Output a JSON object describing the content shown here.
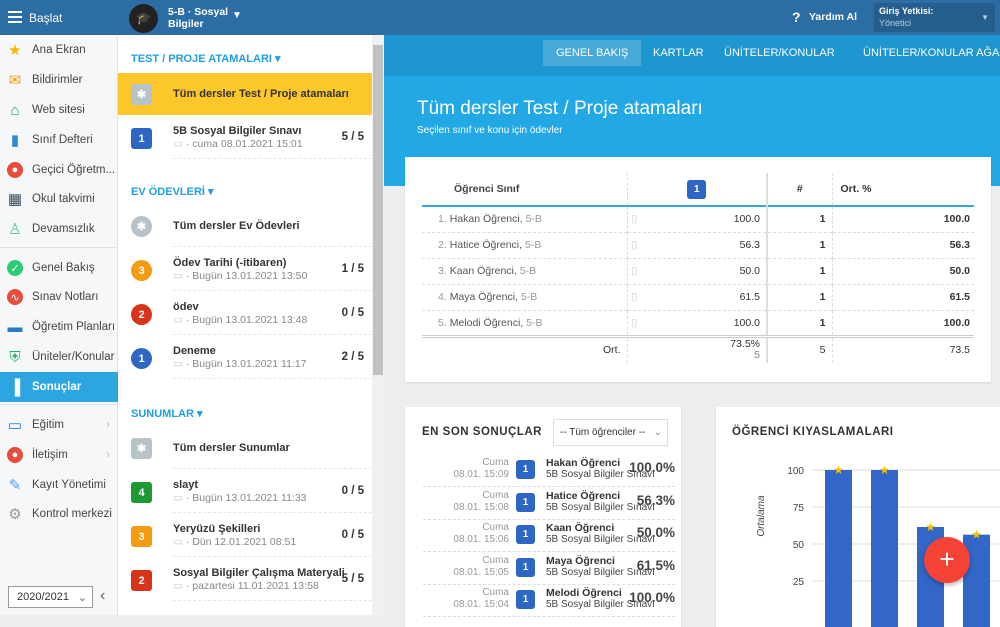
{
  "topbar": {
    "start": "Başlat",
    "course_line1": "5-B · Sosyal",
    "course_line2": "Bilgiler",
    "help": "Yardım Al",
    "auth_label": "Giriş Yetkisi:",
    "auth_value": "Yönetici"
  },
  "sidebar": {
    "items": [
      {
        "label": "Ana Ekran",
        "icon": "star-icon",
        "color": "#f5b800"
      },
      {
        "label": "Bildirimler",
        "icon": "mail-icon",
        "color": "#f39c12"
      },
      {
        "label": "Web sitesi",
        "icon": "home-icon",
        "color": "#17a57a"
      },
      {
        "label": "Sınıf Defteri",
        "icon": "book-icon",
        "color": "#2a8ad8"
      },
      {
        "label": "Geçici Öğretm...",
        "icon": "user-icon",
        "color": "#e74c3c"
      },
      {
        "label": "Okul takvimi",
        "icon": "calendar-icon",
        "color": "#34495e"
      },
      {
        "label": "Devamsızlık",
        "icon": "person-icon",
        "color": "#5cc0a0"
      },
      {
        "label": "Genel Bakış",
        "icon": "check-icon",
        "color": "#2ecc71"
      },
      {
        "label": "Sınav Notları",
        "icon": "chart-icon",
        "color": "#e74c3c"
      },
      {
        "label": "Öğretim Planları",
        "icon": "briefcase-icon",
        "color": "#2a7bc4"
      },
      {
        "label": "Üniteler/Konular",
        "icon": "shield-icon",
        "color": "#27ae60"
      },
      {
        "label": "Sonuçlar",
        "icon": "bar-chart-icon",
        "color": "#ffffff"
      },
      {
        "label": "Eğitim",
        "icon": "open-book-icon",
        "color": "#2a7bc4"
      },
      {
        "label": "İletişim",
        "icon": "chat-icon",
        "color": "#e74c3c"
      },
      {
        "label": "Kayıt Yönetimi",
        "icon": "pen-icon",
        "color": "#5aa0e0"
      },
      {
        "label": "Kontrol merkezi",
        "icon": "gear-icon",
        "color": "#999999"
      }
    ],
    "year": "2020/2021"
  },
  "middle": {
    "tests_title": "TEST / PROJE ATAMALARI",
    "tests": [
      {
        "title": "Tüm dersler Test / Proje atamaları"
      },
      {
        "badge": "1",
        "title": "5B Sosyal Bilgiler Sınavı",
        "sub": "· cuma 08.01.2021 15:01",
        "count": "5 / 5"
      }
    ],
    "homework_title": "EV ÖDEVLERİ",
    "homework": [
      {
        "title": "Tüm dersler Ev Ödevleri"
      },
      {
        "badge": "3",
        "color": "#f39c12",
        "title": "Ödev Tarihi (-itibaren)",
        "sub": "· Bugün 13.01.2021 13:50",
        "count": "1 / 5"
      },
      {
        "badge": "2",
        "color": "#d9331a",
        "title": "ödev",
        "sub": "· Bugün 13.01.2021 13:48",
        "count": "0 / 5"
      },
      {
        "badge": "1",
        "color": "#2e66c4",
        "title": "Deneme",
        "sub": "· Bugün 13.01.2021 11:17",
        "count": "2 / 5"
      }
    ],
    "presentations_title": "SUNUMLAR",
    "presentations": [
      {
        "title": "Tüm dersler Sunumlar"
      },
      {
        "badge": "4",
        "color": "#1e9a34",
        "title": "slayt",
        "sub": "· Bugün 13.01.2021 11:33",
        "count": "0 / 5"
      },
      {
        "badge": "3",
        "color": "#f39c12",
        "title": "Yeryüzü Şekilleri",
        "sub": "· Dün 12.01.2021 08:51",
        "count": "0 / 5"
      },
      {
        "badge": "2",
        "color": "#d9331a",
        "title": "Sosyal Bilgiler Çalışma Materyali",
        "sub": "· pazartesi 11.01.2021 13:58",
        "count": "5 / 5"
      }
    ]
  },
  "tabs": [
    "GENEL BAKIŞ",
    "KARTLAR",
    "ÜNİTELER/KONULAR",
    "ÜNİTELER/KONULAR AĞACI"
  ],
  "hero": {
    "title": "Tüm dersler Test / Proje atamaları",
    "subtitle": "Seçilen sınıf ve konu için ödevler"
  },
  "table": {
    "headers": {
      "student": "Öğrenci Sınıf",
      "test": "1",
      "count": "#",
      "avg": "Ort. %"
    },
    "rows": [
      {
        "num": "1.",
        "name": "Hakan Öğrenci,",
        "cls": "5-B",
        "score": "100.0",
        "count": "1",
        "avg": "100.0"
      },
      {
        "num": "2.",
        "name": "Hatice Öğrenci,",
        "cls": "5-B",
        "score": "56.3",
        "count": "1",
        "avg": "56.3"
      },
      {
        "num": "3.",
        "name": "Kaan Öğrenci,",
        "cls": "5-B",
        "score": "50.0",
        "count": "1",
        "avg": "50.0"
      },
      {
        "num": "4.",
        "name": "Maya Öğrenci,",
        "cls": "5-B",
        "score": "61.5",
        "count": "1",
        "avg": "61.5"
      },
      {
        "num": "5.",
        "name": "Melodi Öğrenci,",
        "cls": "5-B",
        "score": "100.0",
        "count": "1",
        "avg": "100.0"
      }
    ],
    "footer": {
      "label": "Ort.",
      "score": "73.5%",
      "score_n": "5",
      "count": "5",
      "avg": "73.5"
    }
  },
  "recent": {
    "title": "EN SON SONUÇLAR",
    "filter": "-- Tüm öğrenciler --",
    "items": [
      {
        "day": "Cuma",
        "time": "08.01. 15:09",
        "badge": "1",
        "name": "Hakan Öğrenci",
        "test": "5B Sosyal Bilgiler Sınavı",
        "pct": "100.0%"
      },
      {
        "day": "Cuma",
        "time": "08.01. 15:08",
        "badge": "1",
        "name": "Hatice Öğrenci",
        "test": "5B Sosyal Bilgiler Sınavı",
        "pct": "56.3%"
      },
      {
        "day": "Cuma",
        "time": "08.01. 15:06",
        "badge": "1",
        "name": "Kaan Öğrenci",
        "test": "5B Sosyal Bilgiler Sınavı",
        "pct": "50.0%"
      },
      {
        "day": "Cuma",
        "time": "08.01. 15:05",
        "badge": "1",
        "name": "Maya Öğrenci",
        "test": "5B Sosyal Bilgiler Sınavı",
        "pct": "61.5%"
      },
      {
        "day": "Cuma",
        "time": "08.01. 15:04",
        "badge": "1",
        "name": "Melodi Öğrenci",
        "test": "5B Sosyal Bilgiler Sınavı",
        "pct": "100.0%"
      }
    ]
  },
  "compare": {
    "title": "ÖĞRENCİ KIYASLAMALARI"
  },
  "chart_data": {
    "type": "bar",
    "ylabel": "Ortalama",
    "yticks": [
      100,
      75,
      50,
      25
    ],
    "ylim": [
      0,
      100
    ],
    "values": [
      100,
      100,
      61.5,
      56.3
    ],
    "bar_color": "#3266c8",
    "grid": true
  },
  "colors": {
    "topbar": "#2c6ea4",
    "accent": "#22a8e5",
    "highlight": "#fcc72a",
    "fab": "#f44336"
  }
}
